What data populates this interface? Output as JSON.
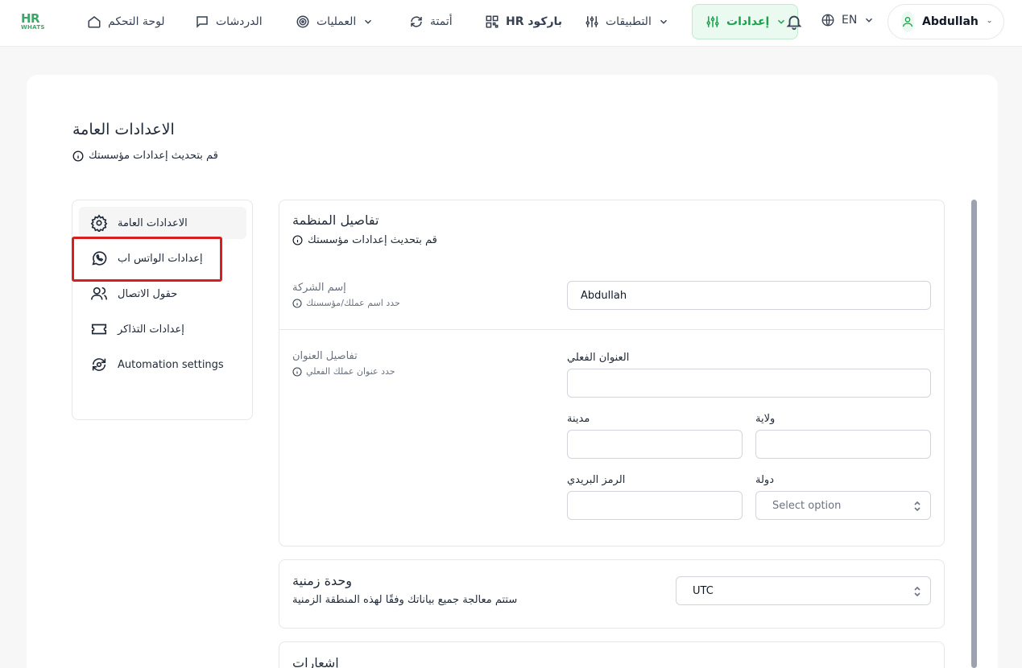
{
  "brand": {
    "logo_top": "HR",
    "logo_bottom": "WHATS",
    "accent": "#16a34a"
  },
  "nav": {
    "dashboard": "لوحة التحكم",
    "chats": "الدردشات",
    "operations": "العمليات",
    "automation": "أتمتة",
    "barcode": "HR باركود",
    "apps": "التطبيقات",
    "settings": "إعدادات",
    "language": "EN",
    "user": "Abdullah"
  },
  "page": {
    "title": "الاعدادات العامة",
    "subtitle": "قم بتحديث إعدادات مؤسستك"
  },
  "sidebar": {
    "items": [
      {
        "label": "الاعدادات العامة",
        "icon": "gear-icon"
      },
      {
        "label": "إعدادات الواتس اب",
        "icon": "whatsapp-icon"
      },
      {
        "label": "حقول الاتصال",
        "icon": "users-icon"
      },
      {
        "label": "إعدادات التذاكر",
        "icon": "ticket-icon"
      },
      {
        "label": "Automation settings",
        "icon": "automation-icon"
      }
    ]
  },
  "org": {
    "title": "تفاصيل المنظمة",
    "subtitle": "قم بتحديث إعدادات مؤسستك",
    "company_label": "إسم الشركة",
    "company_hint": "حدد اسم عملك/مؤسستك",
    "company_value": "Abdullah",
    "address_label": "تفاصيل العنوان",
    "address_hint": "حدد عنوان عملك الفعلي",
    "street_label": "العنوان الفعلي",
    "city_label": "مدينة",
    "state_label": "ولاية",
    "zip_label": "الرمز البريدي",
    "country_label": "دولة",
    "country_placeholder": "Select option"
  },
  "timezone": {
    "title": "وحدة زمنية",
    "subtitle": "ستتم معالجة جميع بياناتك وفقًا لهذه المنطقة الزمنية",
    "value": "UTC"
  },
  "notifications": {
    "title": "إشعارات"
  }
}
